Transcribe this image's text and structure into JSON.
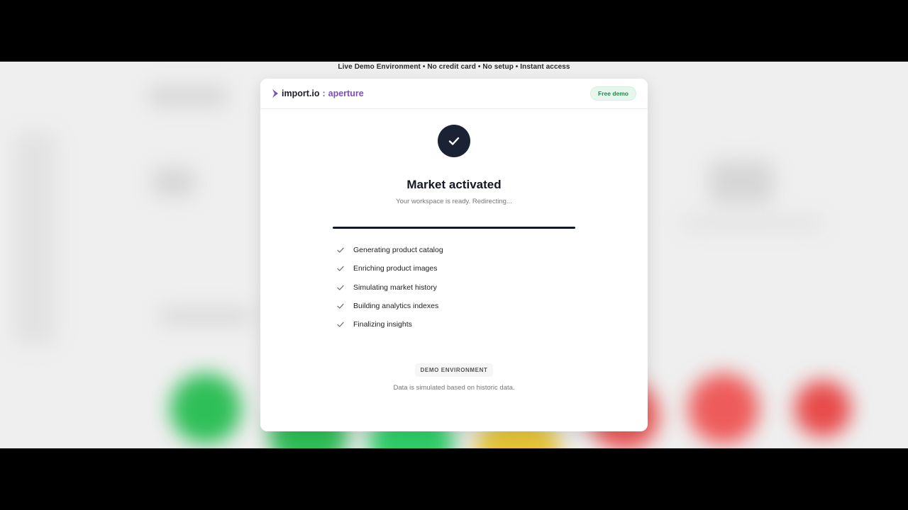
{
  "banner": {
    "text": "Live Demo Environment • No credit card • No setup • Instant access"
  },
  "modal": {
    "logo": {
      "main": "import.io",
      "separator": ":",
      "sub": "aperture"
    },
    "badge": "Free demo",
    "status_icon": "check-icon",
    "title": "Market activated",
    "subtitle": "Your workspace is ready. Redirecting...",
    "progress": {
      "value": 1.0
    },
    "steps": [
      {
        "label": "Generating product catalog",
        "done": true
      },
      {
        "label": "Enriching product images",
        "done": true
      },
      {
        "label": "Simulating market history",
        "done": true
      },
      {
        "label": "Building analytics indexes",
        "done": true
      },
      {
        "label": "Finalizing insights",
        "done": true
      }
    ],
    "env_badge": "DEMO ENVIRONMENT",
    "note": "Data is simulated based on historic data."
  },
  "colors": {
    "accent": "#7a4fc4",
    "dark": "#1a2233",
    "success_bg": "#e7f7ee",
    "success_text": "#1f8a4c"
  }
}
